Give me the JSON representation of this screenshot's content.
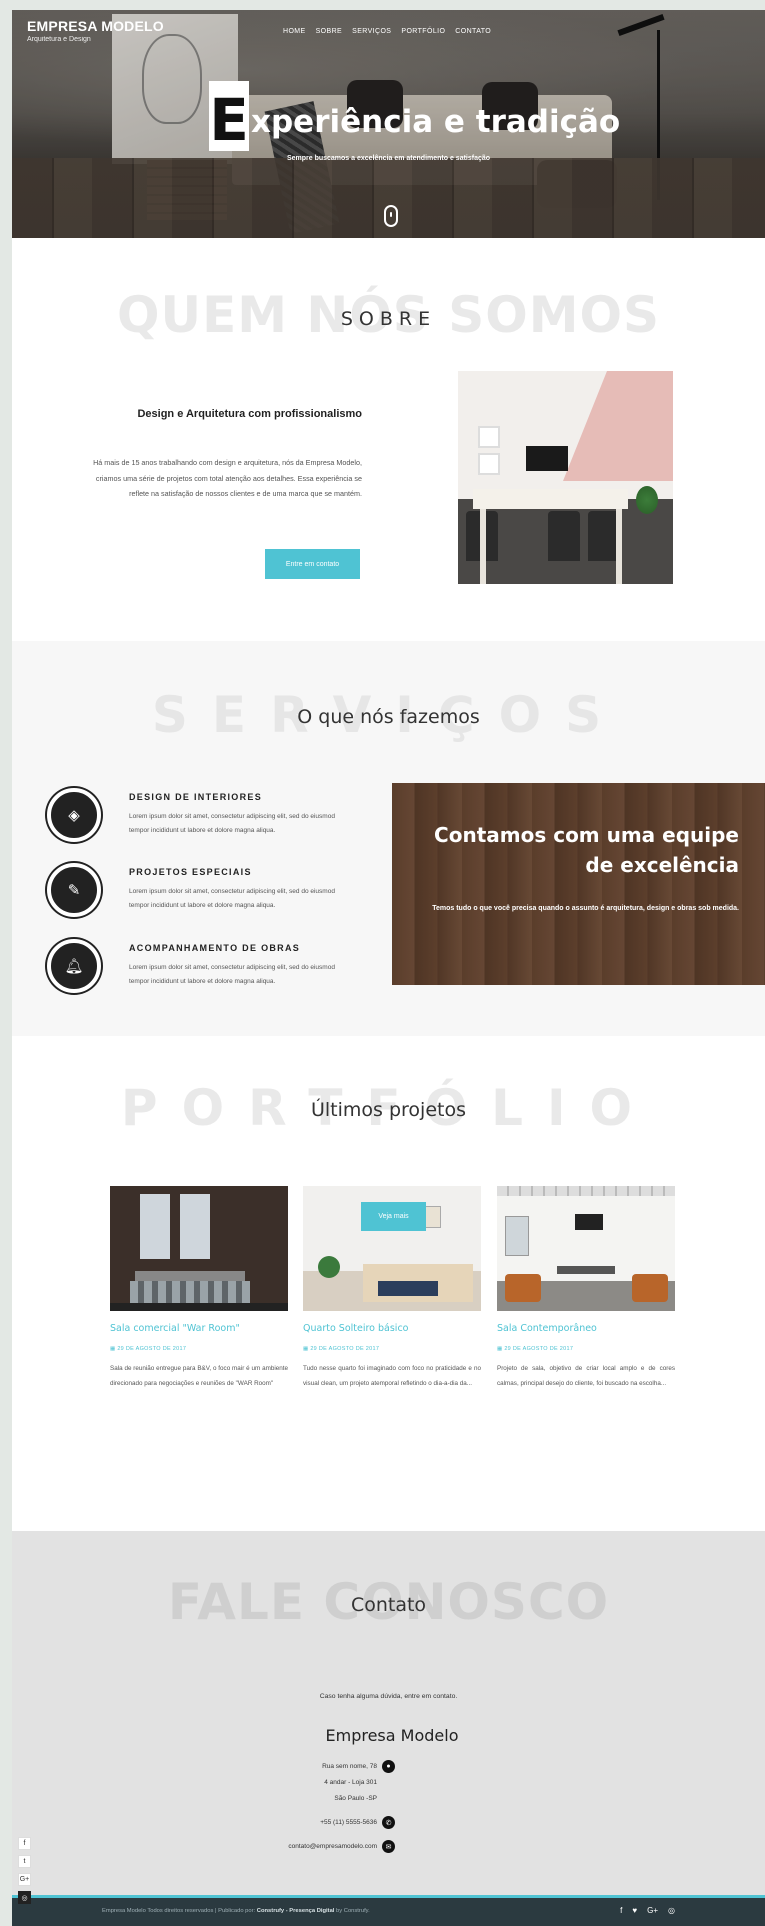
{
  "brand": {
    "name": "EMPRESA MODELO",
    "tagline": "Arquitetura e Design"
  },
  "nav": [
    "HOME",
    "SOBRE",
    "SERVIÇOS",
    "PORTFÓLIO",
    "CONTATO"
  ],
  "hero": {
    "big_letter": "E",
    "title_rest": "xperiência e tradição",
    "subtitle": "Sempre buscamos a excelência em atendimento e satisfação"
  },
  "sobre": {
    "ghost": "QUEM NÓS SOMOS",
    "heading": "SOBRE",
    "title": "Design e Arquitetura com profissionalismo",
    "text": "Há mais de 15 anos trabalhando com design e arquitetura, nós da Empresa Modelo, criamos uma série de projetos com total atenção aos detalhes. Essa experiência se reflete na satisfação de nossos clientes e de uma marca que se mantém.",
    "button": "Entre em contato"
  },
  "servicos": {
    "ghost": "SERVIÇOS",
    "heading": "O que nós fazemos",
    "items": [
      {
        "title": "DESIGN DE INTERIORES",
        "text": "Lorem ipsum dolor sit amet, consectetur adipiscing elit, sed do eiusmod tempor incididunt ut labore et dolore magna aliqua."
      },
      {
        "title": "PROJETOS ESPECIAIS",
        "text": "Lorem ipsum dolor sit amet, consectetur adipiscing elit, sed do eiusmod tempor incididunt ut labore et dolore magna aliqua."
      },
      {
        "title": "ACOMPANHAMENTO DE OBRAS",
        "text": "Lorem ipsum dolor sit amet, consectetur adipiscing elit, sed do eiusmod tempor incididunt ut labore et dolore magna aliqua."
      }
    ],
    "team_title": "Contamos com uma equipe de excelência",
    "team_text": "Temos tudo o que você precisa quando o assunto é arquitetura, design e obras sob medida."
  },
  "portfolio": {
    "ghost": "PORTFÓLIO",
    "heading": "Últimos projetos",
    "cards": [
      {
        "title": "Sala comercial \"War Room\"",
        "date": "29 DE AGOSTO DE 2017",
        "text": "Sala de reunião entregue para B&V, o foco mair é um ambiente direcionado para negociações e reuniões de \"WAR Room\""
      },
      {
        "title": "Quarto Solteiro básico",
        "date": "29 DE AGOSTO DE 2017",
        "text": "Tudo nesse quarto foi imaginado com foco no praticidade e no visual clean, um projeto atemporal refletindo o dia-a-dia da..."
      },
      {
        "title": "Sala Contemporâneo",
        "date": "29 DE AGOSTO DE 2017",
        "text": "Projeto de sala, objetivo de criar local amplo e de cores calmas, principal desejo do cliente, foi buscado na escolha..."
      }
    ],
    "button": "Veja mais"
  },
  "contato": {
    "ghost": "FALE CONOSCO",
    "heading": "Contato",
    "intro": "Caso tenha alguma dúvida, entre em contato.",
    "company": "Empresa Modelo",
    "address1": "Rua sem nome, 78",
    "address2": "4 andar - Loja 301",
    "address3": "São Paulo -SP",
    "phone": "+55 (11) 5555-5636",
    "email": "contato@empresamodelo.com"
  },
  "footer": {
    "text": "Empresa Modelo Todos direitos reservados | Publicado por: ",
    "publisher": "Construfy - Presença Digital",
    "by": " by Construfy."
  },
  "colors": {
    "accent": "#4fc3d3",
    "footer_bg": "#2b3a40"
  }
}
